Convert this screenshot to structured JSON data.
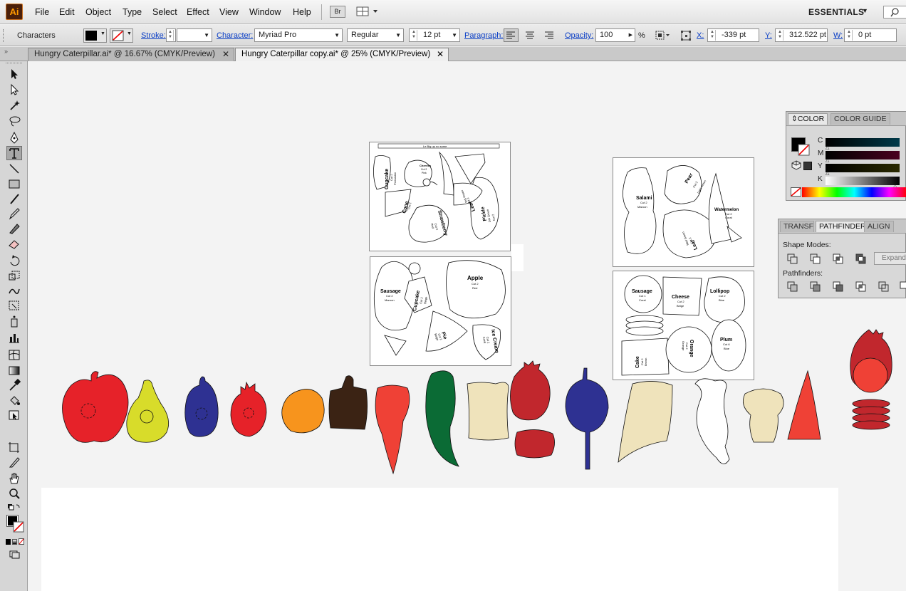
{
  "app": {
    "logo": "Ai",
    "workspace": "ESSENTIALS",
    "bridge_label": "Br"
  },
  "menu": [
    "File",
    "Edit",
    "Object",
    "Type",
    "Select",
    "Effect",
    "View",
    "Window",
    "Help"
  ],
  "control_bar": {
    "panel_name": "Characters",
    "stroke_label": "Stroke:",
    "stroke_value": "",
    "character_label": "Character:",
    "font_family": "Myriad Pro",
    "font_style": "Regular",
    "font_size": "12 pt",
    "paragraph_label": "Paragraph:",
    "opacity_label": "Opacity:",
    "opacity_value": "100",
    "opacity_unit": "%",
    "x_label": "X:",
    "x_value": "-339 pt",
    "y_label": "Y:",
    "y_value": "312.522 pt",
    "w_label": "W:",
    "w_value": "0 pt"
  },
  "tabs": [
    {
      "label": "Hungry Caterpillar.ai* @ 16.67% (CMYK/Preview)",
      "active": false
    },
    {
      "label": "Hungry Caterpillar copy.ai* @ 25% (CMYK/Preview)",
      "active": true
    }
  ],
  "tools": [
    "selection-tool",
    "direct-selection-tool",
    "magic-wand-tool",
    "lasso-tool",
    "pen-tool",
    "type-tool",
    "line-segment-tool",
    "rectangle-tool",
    "paintbrush-tool",
    "pencil-tool",
    "blob-brush-tool",
    "eraser-tool",
    "rotate-tool",
    "scale-tool",
    "warp-tool",
    "free-transform-tool",
    "symbol-sprayer-tool",
    "column-graph-tool",
    "mesh-tool",
    "gradient-tool",
    "eyedropper-tool",
    "live-paint-bucket-tool",
    "live-paint-selection-tool",
    "artboard-tool",
    "slice-tool",
    "hand-tool",
    "zoom-tool"
  ],
  "color_panel": {
    "tabs": [
      "COLOR",
      "COLOR GUIDE"
    ],
    "channels": [
      "C",
      "M",
      "Y",
      "K"
    ]
  },
  "pathfinder_panel": {
    "tabs": [
      "TRANSFO",
      "PATHFINDER",
      "ALIGN"
    ],
    "shape_modes_label": "Shape Modes:",
    "expand_label": "Expand",
    "pathfinders_label": "Pathfinders:"
  },
  "sheets": {
    "sheet1": {
      "header": "Le Big up no some",
      "labels": [
        "Cupcake",
        "Cut 2",
        "Periwinkle",
        "Cone",
        "Cut 2",
        "Cherries",
        "Cut 2",
        "Pink",
        "Leaf",
        "Cut 2",
        "Drk Green",
        "Strawberry",
        "Cut 2",
        "Red",
        "Pickle",
        "Cut 2",
        "Drk Green"
      ]
    },
    "sheet2": {
      "labels": [
        "Salami",
        "Cut 2",
        "Maroon",
        "Pear",
        "Cut 2",
        "Light Green",
        "Watermelon",
        "Cut 2",
        "Coral",
        "Leaf",
        "Cut 2",
        "Med Green"
      ]
    },
    "sheet3": {
      "labels": [
        "Sausage",
        "Cut 2",
        "Maroon",
        "Cupcake",
        "Cut 2",
        "Beige",
        "Apple",
        "Cut 2",
        "Red",
        "Pie",
        "Cut 2",
        "Beige",
        "Ice Cream",
        "Cut 2",
        "Coral"
      ]
    },
    "sheet4": {
      "labels": [
        "Sausage",
        "Cut 1",
        "Coral",
        "Cheese",
        "Cut 2",
        "Beige",
        "Lollipop",
        "Cut 2",
        "Blue",
        "Orange",
        "Cut 2",
        "Orange",
        "Plum",
        "Cut 6",
        "Blue",
        "Cake",
        "Cut 2",
        "Brown"
      ]
    }
  },
  "colors": {
    "apple_red": "#e62229",
    "pear_green": "#d8dc2a",
    "plum_blue": "#2e3192",
    "orange": "#f7941d",
    "chocolate": "#3b2314",
    "coral": "#ef4136",
    "pickle_green": "#0b6b35",
    "beige": "#efe3bb",
    "maroon": "#c1272d",
    "white": "#ffffff"
  }
}
